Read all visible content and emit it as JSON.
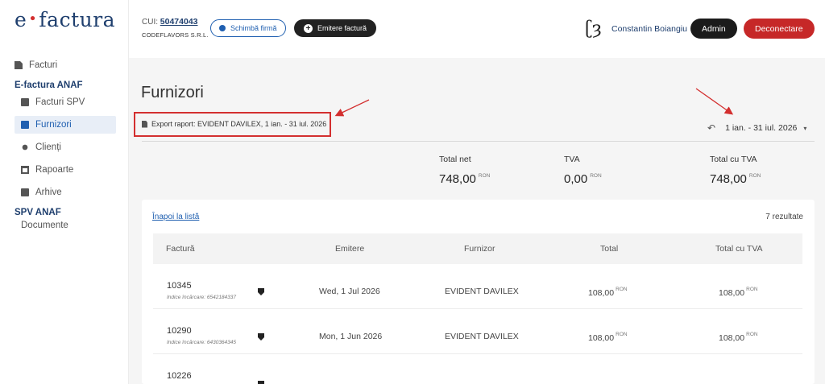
{
  "sidebar": {
    "logo_e": "e",
    "logo_dot": "•",
    "logo_text": "factura",
    "items": [
      {
        "label": "Facturi",
        "icon": "document-icon"
      },
      {
        "label": "Facturi SPV",
        "icon": "document-icon"
      },
      {
        "label": "Furnizori",
        "icon": "card-icon"
      },
      {
        "label": "Clienți",
        "icon": "users-icon"
      },
      {
        "label": "Rapoarte",
        "icon": "calendar-icon"
      },
      {
        "label": "Arhive",
        "icon": "archive-icon"
      }
    ],
    "section_anaf": "E-factura ANAF",
    "section_spv": "SPV ANAF",
    "documents": "Documente"
  },
  "header": {
    "cui_label": "CUI:",
    "cui_value": "50474043",
    "company": "CODEFLAVORS S.R.L.",
    "change_company": "Schimbă firmă",
    "issue_invoice": "Emitere factură",
    "brand_mark": "ʗȝ",
    "user_name": "Constantin Boiangiu",
    "admin": "Admin",
    "logout": "Deconectare"
  },
  "main": {
    "title": "Furnizori",
    "export_link": "Export raport: EVIDENT DAVILEX, 1 ian. - 31 iul. 2026",
    "undo_icon": "↶",
    "range": "1 ian. - 31 iul. 2026",
    "caret": "▾",
    "totals": [
      {
        "label": "Total net",
        "value": "748,00",
        "currency": "RON"
      },
      {
        "label": "TVA",
        "value": "0,00",
        "currency": "RON"
      },
      {
        "label": "Total cu TVA",
        "value": "748,00",
        "currency": "RON"
      }
    ],
    "back_link": "Înapoi la listă",
    "results": "7 rezultate",
    "columns": [
      "Factură",
      "Emitere",
      "Furnizor",
      "Total",
      "Total cu TVA"
    ],
    "rows": [
      {
        "number": "10345",
        "index": "Indice încărcare: 6542184337",
        "date": "Wed, 1 Jul 2026",
        "supplier": "EVIDENT DAVILEX",
        "total": "108,00",
        "total_vat": "108,00",
        "currency": "RON"
      },
      {
        "number": "10290",
        "index": "Indice încărcare: 6430364345",
        "date": "Mon, 1 Jun 2026",
        "supplier": "EVIDENT DAVILEX",
        "total": "108,00",
        "total_vat": "108,00",
        "currency": "RON"
      },
      {
        "number": "10226",
        "index": "",
        "date": "",
        "supplier": "",
        "total": "",
        "total_vat": "",
        "currency": ""
      }
    ]
  },
  "colors": {
    "accent": "#1f5fb0",
    "danger": "#c62828",
    "annotation": "#d32f2f"
  }
}
